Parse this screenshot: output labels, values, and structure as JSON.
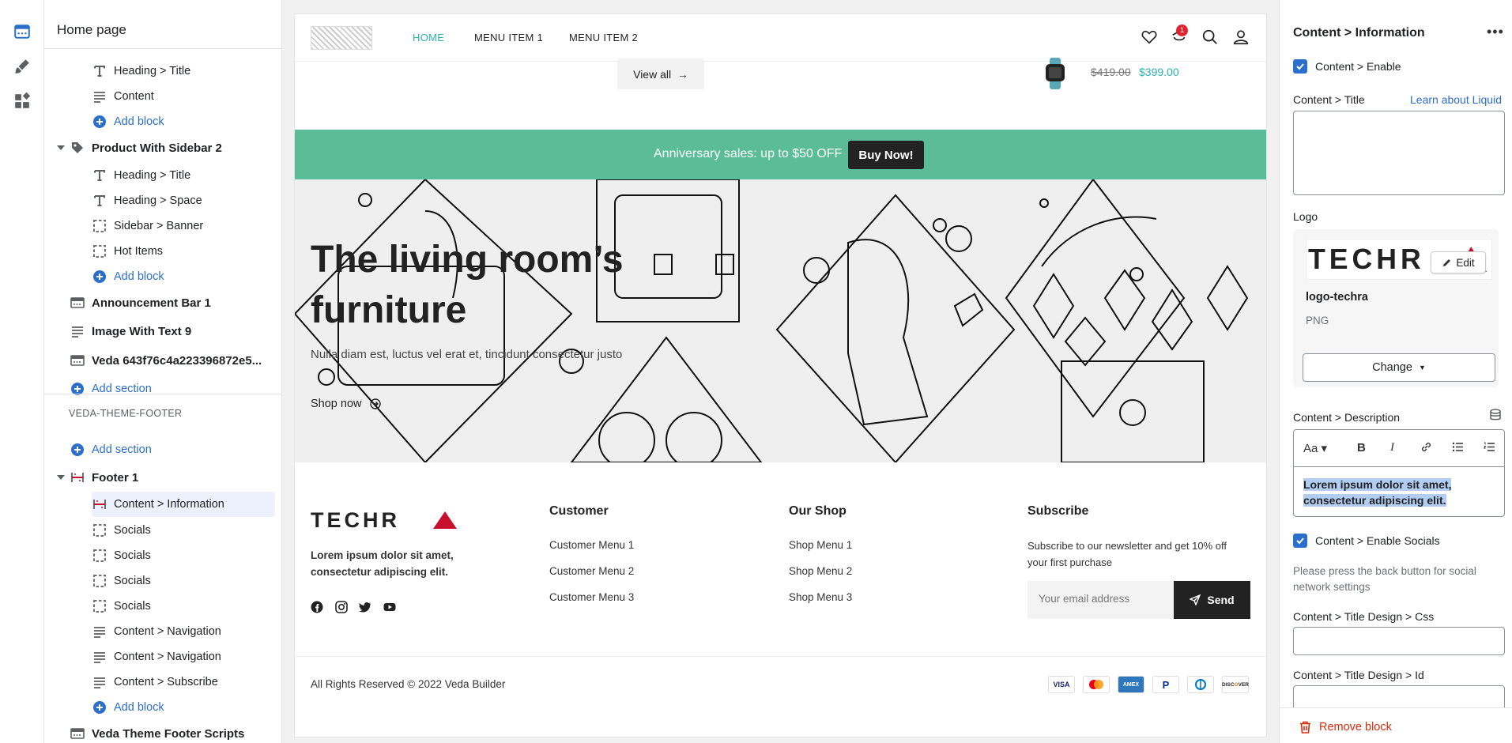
{
  "sidebar": {
    "title": "Home page",
    "rows": [
      {
        "label": "Heading > Title",
        "icon": "text-icon"
      },
      {
        "label": "Content",
        "icon": "paragraph-icon"
      },
      {
        "label": "Add block",
        "icon": "plus-circle-icon"
      },
      {
        "label": "Product With Sidebar 2",
        "icon": "tag-icon"
      },
      {
        "label": "Heading > Title",
        "icon": "text-icon"
      },
      {
        "label": "Heading > Space",
        "icon": "text-icon"
      },
      {
        "label": "Sidebar > Banner",
        "icon": "dashed-square-icon"
      },
      {
        "label": "Hot Items",
        "icon": "dashed-square-icon"
      },
      {
        "label": "Add block",
        "icon": "plus-circle-icon"
      },
      {
        "label": "Announcement Bar 1",
        "icon": "layout-icon"
      },
      {
        "label": "Image With Text 9",
        "icon": "paragraph-icon"
      },
      {
        "label": "Veda 643f76c4a223396872e5...",
        "icon": "layout-icon"
      },
      {
        "label": "Add section",
        "icon": "plus-circle-icon"
      }
    ],
    "footer_group": "VEDA-THEME-FOOTER",
    "footer_rows": [
      {
        "label": "Add section",
        "icon": "plus-circle-icon"
      },
      {
        "label": "Footer 1",
        "icon": "footer-icon"
      },
      {
        "label": "Content > Information",
        "icon": "footer-icon"
      },
      {
        "label": "Socials",
        "icon": "dashed-square-icon"
      },
      {
        "label": "Socials",
        "icon": "dashed-square-icon"
      },
      {
        "label": "Socials",
        "icon": "dashed-square-icon"
      },
      {
        "label": "Socials",
        "icon": "dashed-square-icon"
      },
      {
        "label": "Content > Navigation",
        "icon": "paragraph-icon"
      },
      {
        "label": "Content > Navigation",
        "icon": "paragraph-icon"
      },
      {
        "label": "Content > Subscribe",
        "icon": "paragraph-icon"
      },
      {
        "label": "Add block",
        "icon": "plus-circle-icon"
      },
      {
        "label": "Veda Theme Footer Scripts",
        "icon": "layout-icon"
      }
    ]
  },
  "preview": {
    "nav": {
      "links": [
        "HOME",
        "MENU ITEM 1",
        "MENU ITEM 2"
      ],
      "cart_count": "1"
    },
    "view_all": "View all",
    "price_old": "$419.00",
    "price_new": "$399.00",
    "announcement": {
      "text": "Anniversary sales: up to $50 OFF",
      "button": "Buy Now!"
    },
    "hero": {
      "title": "The living room’s furniture",
      "subtitle": "Nulla diam est, luctus vel erat et, tincidunt consectetur justo",
      "cta": "Shop now"
    },
    "footer": {
      "logo_text": "TECHR",
      "tagline": "Lorem ipsum dolor sit amet, consectetur adipiscing elit.",
      "customer": {
        "title": "Customer",
        "links": [
          "Customer Menu 1",
          "Customer Menu 2",
          "Customer Menu 3"
        ]
      },
      "shop": {
        "title": "Our Shop",
        "links": [
          "Shop Menu 1",
          "Shop Menu 2",
          "Shop Menu 3"
        ]
      },
      "subscribe": {
        "title": "Subscribe",
        "text": "Subscribe to our newsletter and get 10% off your first purchase",
        "placeholder": "Your email address",
        "button": "Send"
      },
      "copyright": "All Rights Reserved © 2022 Veda Builder",
      "payments": [
        "VISA",
        "MC",
        "AMEX",
        "PayPal",
        "Diners",
        "DISCOVER"
      ]
    }
  },
  "panel": {
    "title": "Content > Information",
    "enable_label": "Content > Enable",
    "title_label": "Content > Title",
    "liquid_link": "Learn about Liquid",
    "logo_label": "Logo",
    "logo_preview_text": "TECHR",
    "edit_label": "Edit",
    "logo_name": "logo-techra",
    "logo_type": "PNG",
    "change_label": "Change",
    "description_label": "Content > Description",
    "description_text": "Lorem ipsum dolor sit amet, consectetur adipiscing elit.",
    "enable_socials_label": "Content > Enable Socials",
    "socials_hint": "Please press the back button for social network settings",
    "css_label": "Content > Title Design > Css",
    "id_label": "Content > Title Design > Id",
    "remove_label": "Remove block"
  },
  "colors": {
    "accent": "#2c6ecb",
    "teal": "#2ab3ac",
    "announce": "#5bbc98",
    "danger": "#d72c0d",
    "brand_red": "#c8102e"
  }
}
